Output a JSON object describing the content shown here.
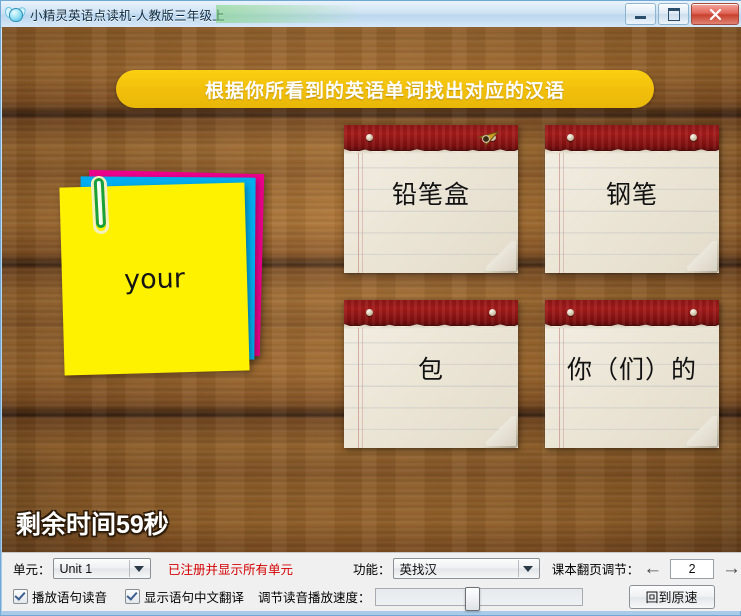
{
  "window": {
    "title": "小精灵英语点读机-人教版三年级上",
    "icon": "fairy-sprite-icon",
    "buttons": {
      "minimize": "–",
      "maximize": "□",
      "close": "✕"
    }
  },
  "banner": {
    "text": "根据你所看到的英语单词找出对应的汉语"
  },
  "prompt_note": {
    "word": "your",
    "colors": [
      "#fff200",
      "#00aeef",
      "#ec008c"
    ]
  },
  "cards": [
    {
      "label": "铅笔盒"
    },
    {
      "label": "钢笔"
    },
    {
      "label": "包"
    },
    {
      "label": "你（们）的"
    }
  ],
  "timer": {
    "text": "剩余时间59秒",
    "seconds": 59
  },
  "panel": {
    "unit_label": "单元：",
    "unit_value": "Unit 1",
    "registration_notice": "已注册并显示所有单元",
    "function_label": "功能：",
    "function_value": "英找汉",
    "page_label": "课本翻页调节：",
    "page_prev": "←",
    "page_value": "2",
    "page_next": "→",
    "checkbox_play_audio": "播放语句读音",
    "checkbox_show_translation": "显示语句中文翻译",
    "speed_label": "调节读音播放速度：",
    "reset_speed_button": "回到原速"
  },
  "colors": {
    "banner_bg": "#f2c00c",
    "notice_red": "#d40000",
    "card_header": "#a51b1b",
    "note_yellow": "#fff200"
  }
}
